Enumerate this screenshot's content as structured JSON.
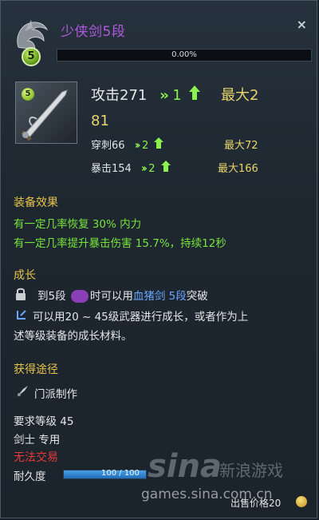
{
  "header": {
    "title": "少侠剑5段",
    "level_badge": "5",
    "close_label": "×",
    "exp_percent": 0,
    "exp_text": "0.00%"
  },
  "item": {
    "icon_badge": "5",
    "attack": {
      "label": "攻击271",
      "gain": "1",
      "max_label_line1": "最大2",
      "max_label_line2": "81"
    },
    "pierce": {
      "label": "穿刺66",
      "gain": "2",
      "max": "最大72"
    },
    "crit": {
      "label": "暴击154",
      "gain": "2",
      "max": "最大166"
    }
  },
  "effects": {
    "title": "装备效果",
    "lines": [
      "有一定几率恢复 30% 内力",
      "有一定几率提升暴击伤害 15.7%，持续12秒"
    ]
  },
  "growth": {
    "title": "成长",
    "line1_a": "到5段",
    "line1_b": "时可以用",
    "line1_link": "血猪剑 5段",
    "line1_c": "突破",
    "line2": "可以用20 ~ 45级武器进行成长，或者作为上",
    "line3": "述等级装备的成长材料。"
  },
  "source": {
    "title": "获得途径",
    "item": "门派制作"
  },
  "requirements": {
    "level": "要求等级 45",
    "class": "剑士 专用",
    "trade": "无法交易",
    "durability_label": "耐久度",
    "durability_text": "100 / 100",
    "durability_value": 1.0
  },
  "footer": {
    "sell_price": "出售价格20"
  },
  "watermark": {
    "brand": "sina",
    "brand_cn": "新浪游戏",
    "url": "games.sina.com.cn"
  },
  "colors": {
    "title": "#b05ae0",
    "green": "#77e43d",
    "gold": "#e8d46a",
    "section": "#e6c34a",
    "link": "#6aa6ff"
  }
}
